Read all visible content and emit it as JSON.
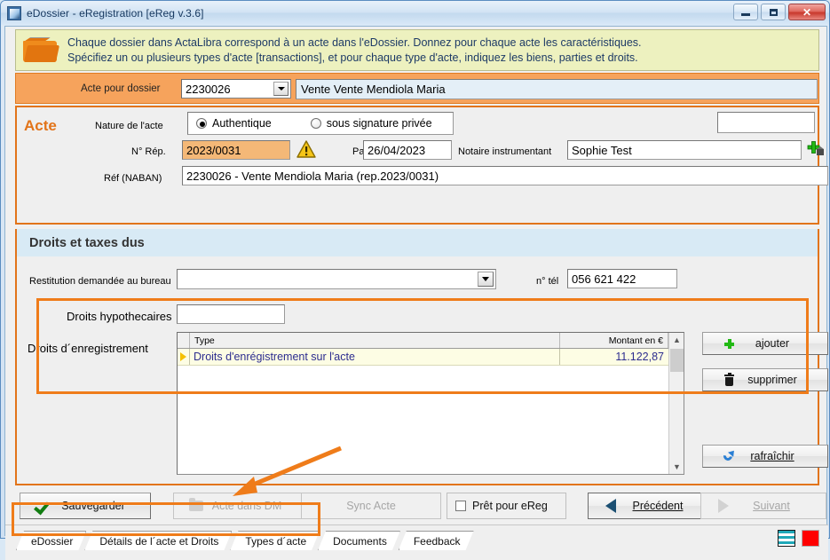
{
  "window": {
    "title": "eDossier - eRegistration [eReg v.3.6]",
    "minimize_label": "",
    "maximize_label": "",
    "close_label": "✕"
  },
  "banner": {
    "line1": "Chaque dossier dans ActaLibra correspond à un acte dans l'eDossier.  Donnez pour chaque acte les caractéristiques.",
    "line2": "Spécifiez un ou plusieurs types d'acte [transactions], et pour chaque type d'acte, indiquez les biens, parties et droits."
  },
  "dossier_bar": {
    "label": "Acte pour dossier",
    "combo_value": "2230026",
    "dossier_name": "Vente Vente Mendiola Maria"
  },
  "acte": {
    "title": "Acte",
    "nature_label": "Nature de l'acte",
    "radio_authentique": "Authentique",
    "radio_sous_signature": "sous signature privée",
    "rep_label": "N° Rép.",
    "rep_value": "2023/0031",
    "passe_label": "Passé",
    "passe_value": "26/04/2023",
    "notaire_label": "Notaire instrumentant",
    "notaire_value": "Sophie Test",
    "ref_label": "Réf (NABAN)",
    "ref_value": "2230026 - Vente Mendiola Maria (rep.2023/0031)",
    "extra_box_value": ""
  },
  "droits": {
    "section_title": "Droits et taxes dus",
    "restitution_label": "Restitution demandée au bureau",
    "restitution_value": "",
    "tel_label": "n° tél",
    "tel_value": "056 621 422",
    "hypothecaires_label": "Droits hypothecaires",
    "hypothecaires_value": "",
    "enregistrement_label": "Droits d´enregistrement"
  },
  "grid": {
    "columns": [
      "Type",
      "Montant en €"
    ],
    "rows": [
      {
        "type": "Droits d'enrégistrement sur l'acte",
        "amount": "11.122,87"
      }
    ]
  },
  "side_buttons": {
    "ajouter": "ajouter",
    "supprimer": "supprimer",
    "rafraichir": "rafraîchir"
  },
  "bottom_buttons": {
    "sauvegarder": "Sauvegarder",
    "acte_dans_dm": "Acte dans DM",
    "sync_acte": "Sync Acte",
    "pret_pour_ereg": "Prêt pour eReg",
    "precedent": "Précédent",
    "suivant": "Suivant"
  },
  "tabs": [
    {
      "label": "eDossier",
      "active": false
    },
    {
      "label": "Détails de l´acte et Droits",
      "active": false
    },
    {
      "label": "Types d´acte",
      "active": true
    },
    {
      "label": "Documents",
      "active": false
    },
    {
      "label": "Feedback",
      "active": false
    }
  ],
  "colors": {
    "accent_orange": "#ef7c1a",
    "panel_orange": "#f6a35c",
    "banner_yellow": "#edf1bf",
    "section_blue": "#d8eaf5",
    "row_yellow": "#fdfde4",
    "status_red": "#ff0000",
    "status_teal": "#1fa8b8"
  }
}
